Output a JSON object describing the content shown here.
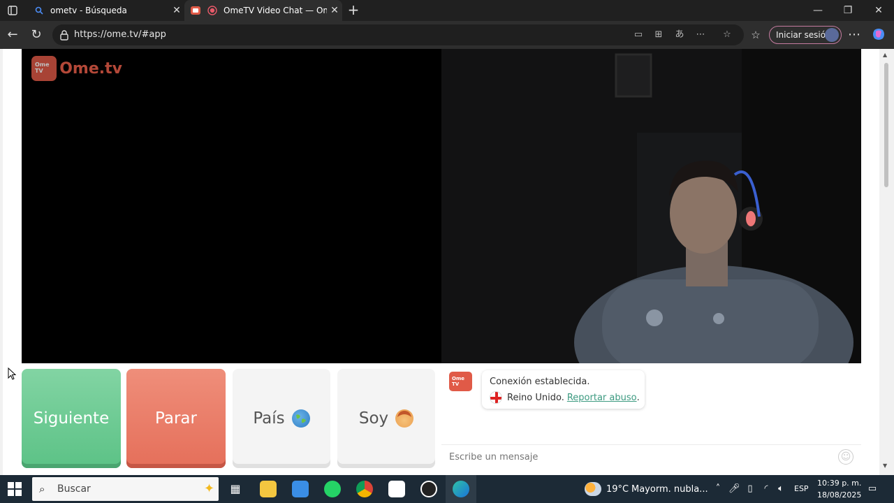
{
  "browser": {
    "tabs": [
      {
        "title": "ometv - Búsqueda"
      },
      {
        "title": "OmeTV Video Chat — Omeg"
      }
    ],
    "url": "https://ome.tv/#app",
    "signin_label": "Iniciar sesión"
  },
  "app": {
    "logo_text": "Ome.tv",
    "logo_badge": "Ome TV",
    "buttons": {
      "next": "Siguiente",
      "stop": "Parar",
      "country": "País",
      "iam": "Soy"
    },
    "chat": {
      "message_line1": "Conexión establecida.",
      "country": "Reino Unido.",
      "report_link": "Reportar abuso",
      "report_suffix": ".",
      "input_placeholder": "Escribe un mensaje"
    },
    "colors": {
      "next": "#5cc286",
      "stop": "#e56f5a",
      "accent": "#e05a47",
      "link": "#3c9a80"
    }
  },
  "taskbar": {
    "search_placeholder": "Buscar",
    "weather_temp": "19°C",
    "weather_text": "Mayorm. nubla...",
    "language": "ESP",
    "time": "10:39 p. m.",
    "date": "18/08/2025"
  }
}
